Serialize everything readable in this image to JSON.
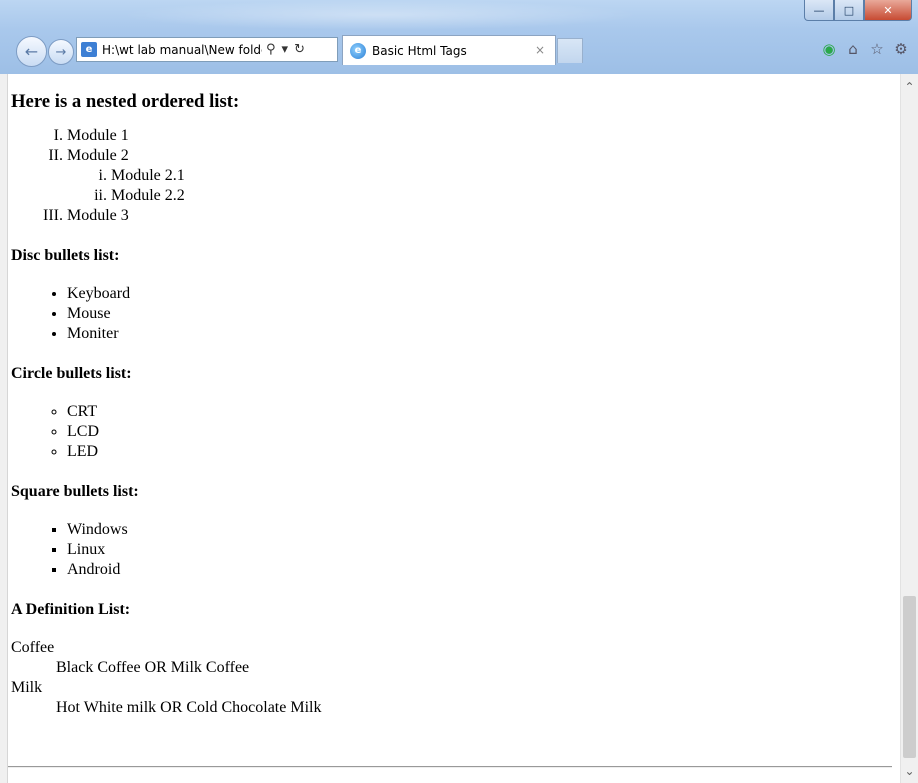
{
  "browser": {
    "address": "H:\\wt lab manual\\New folde",
    "tab_title": "Basic Html Tags",
    "tab_close": "×",
    "nav": {
      "back_icon": "arrow-left",
      "forward_icon": "arrow-right"
    },
    "toolbar_icons": [
      "search-icon",
      "dropdown-icon",
      "refresh-icon"
    ],
    "right_icons": [
      "webslice-icon",
      "home-icon",
      "favorites-star-icon",
      "settings-gear-icon"
    ]
  },
  "page": {
    "ordered_heading": "Here is a nested ordered list:",
    "ordered_list": [
      {
        "label": "Module 1",
        "children": []
      },
      {
        "label": "Module 2",
        "children": [
          "Module 2.1",
          "Module 2.2"
        ]
      },
      {
        "label": "Module 3",
        "children": []
      }
    ],
    "disc_heading": "Disc bullets list:",
    "disc_items": [
      "Keyboard",
      "Mouse",
      "Moniter"
    ],
    "circle_heading": "Circle bullets list:",
    "circle_items": [
      "CRT",
      "LCD",
      "LED"
    ],
    "square_heading": "Square bullets list:",
    "square_items": [
      "Windows",
      "Linux",
      "Android"
    ],
    "definition_heading": "A Definition List:",
    "definitions": [
      {
        "term": "Coffee",
        "desc": "Black Coffee OR Milk Coffee"
      },
      {
        "term": "Milk",
        "desc": "Hot White milk OR Cold Chocolate Milk"
      }
    ]
  },
  "colors": {
    "chrome": "#a9c8ec",
    "close_button": "#c74b33",
    "home_green": "#2aa84a"
  }
}
